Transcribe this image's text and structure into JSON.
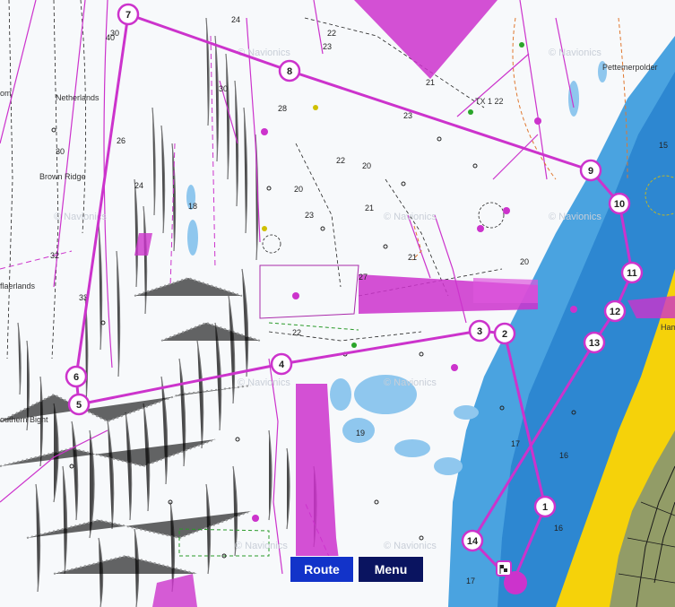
{
  "route": {
    "color": "#cc33cc",
    "waypoints": [
      {
        "label": "7"
      },
      {
        "label": "8"
      },
      {
        "label": "9"
      },
      {
        "label": "10"
      },
      {
        "label": "11"
      },
      {
        "label": "12"
      },
      {
        "label": "13"
      },
      {
        "label": "14"
      },
      {
        "label": "1"
      },
      {
        "label": "2"
      },
      {
        "label": "3"
      },
      {
        "label": "4"
      },
      {
        "label": "5"
      },
      {
        "label": "6"
      }
    ]
  },
  "places": {
    "netherlands": "Netherlands",
    "brown_ridge": "Brown Ridge",
    "flaerlands": "flaerlands",
    "southern_bight": "outhern Bight",
    "petten": "Pettemerpolder",
    "ham": "Ham",
    "tx": "TX 1 22",
    "om": "om"
  },
  "watermark": "© Navionics",
  "buttons": {
    "route_label": "Route",
    "menu_label": "Menu"
  },
  "depths": [
    "24",
    "22",
    "23",
    "21",
    "23",
    "20",
    "30",
    "26",
    "24",
    "22",
    "18",
    "30",
    "28",
    "20",
    "21",
    "23",
    "27",
    "22",
    "17",
    "16",
    "15",
    "19",
    "20",
    "40",
    "32",
    "30",
    "33",
    "21",
    "17",
    "16"
  ],
  "colors": {
    "deep_water": "#f7f9fb",
    "shallow_water": "#4aa3e0",
    "land": "#f5d20a",
    "magenta": "#cc33cc",
    "route_button": "#1233c9",
    "menu_button": "#0a1460"
  }
}
